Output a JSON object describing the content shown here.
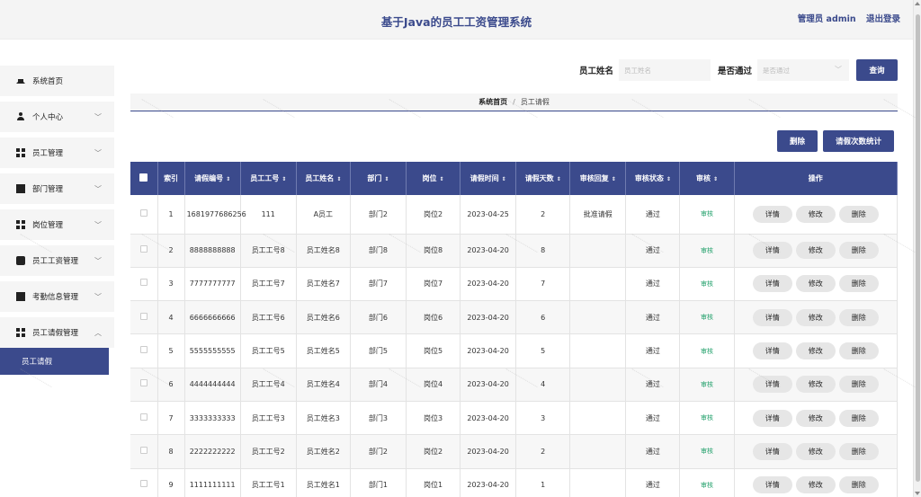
{
  "header": {
    "title": "基于Java的员工工资管理系统",
    "user": "管理员 admin",
    "logout": "退出登录"
  },
  "sidebar": {
    "items": [
      {
        "label": "系统首页",
        "icon": "home-icon"
      },
      {
        "label": "个人中心",
        "icon": "user-icon"
      },
      {
        "label": "员工管理",
        "icon": "grid-icon"
      },
      {
        "label": "部门管理",
        "icon": "trash-icon"
      },
      {
        "label": "岗位管理",
        "icon": "grid-icon"
      },
      {
        "label": "员工工资管理",
        "icon": "chat-icon"
      },
      {
        "label": "考勤信息管理",
        "icon": "chart-icon"
      },
      {
        "label": "员工请假管理",
        "icon": "grid-icon"
      }
    ],
    "active_sub": "员工请假"
  },
  "search": {
    "name_label": "员工姓名",
    "name_placeholder": "员工姓名",
    "pass_label": "是否通过",
    "pass_placeholder": "是否通过",
    "button": "查询"
  },
  "breadcrumb": {
    "home": "系统首页",
    "sep": "/",
    "current": "员工请假"
  },
  "actions": {
    "delete": "删除",
    "stats": "请假次数统计"
  },
  "table": {
    "headers": [
      "索引",
      "请假编号",
      "员工工号",
      "员工姓名",
      "部门",
      "岗位",
      "请假时间",
      "请假天数",
      "审核回复",
      "审核状态",
      "审核",
      "操作"
    ],
    "rows": [
      {
        "idx": "1",
        "code": "1681977686256",
        "emp_no": "111",
        "name": "A员工",
        "dept": "部门2",
        "post": "岗位2",
        "date": "2023-04-25",
        "days": "2",
        "reply": "批准请假",
        "status": "通过",
        "audit": "审核"
      },
      {
        "idx": "2",
        "code": "8888888888",
        "emp_no": "员工工号8",
        "name": "员工姓名8",
        "dept": "部门8",
        "post": "岗位8",
        "date": "2023-04-20",
        "days": "8",
        "reply": "",
        "status": "通过",
        "audit": "审核"
      },
      {
        "idx": "3",
        "code": "7777777777",
        "emp_no": "员工工号7",
        "name": "员工姓名7",
        "dept": "部门7",
        "post": "岗位7",
        "date": "2023-04-20",
        "days": "7",
        "reply": "",
        "status": "通过",
        "audit": "审核"
      },
      {
        "idx": "4",
        "code": "6666666666",
        "emp_no": "员工工号6",
        "name": "员工姓名6",
        "dept": "部门6",
        "post": "岗位6",
        "date": "2023-04-20",
        "days": "6",
        "reply": "",
        "status": "通过",
        "audit": "审核"
      },
      {
        "idx": "5",
        "code": "5555555555",
        "emp_no": "员工工号5",
        "name": "员工姓名5",
        "dept": "部门5",
        "post": "岗位5",
        "date": "2023-04-20",
        "days": "5",
        "reply": "",
        "status": "通过",
        "audit": "审核"
      },
      {
        "idx": "6",
        "code": "4444444444",
        "emp_no": "员工工号4",
        "name": "员工姓名4",
        "dept": "部门4",
        "post": "岗位4",
        "date": "2023-04-20",
        "days": "4",
        "reply": "",
        "status": "通过",
        "audit": "审核"
      },
      {
        "idx": "7",
        "code": "3333333333",
        "emp_no": "员工工号3",
        "name": "员工姓名3",
        "dept": "部门3",
        "post": "岗位3",
        "date": "2023-04-20",
        "days": "3",
        "reply": "",
        "status": "通过",
        "audit": "审核"
      },
      {
        "idx": "8",
        "code": "2222222222",
        "emp_no": "员工工号2",
        "name": "员工姓名2",
        "dept": "部门2",
        "post": "岗位2",
        "date": "2023-04-20",
        "days": "2",
        "reply": "",
        "status": "通过",
        "audit": "审核"
      },
      {
        "idx": "9",
        "code": "1111111111",
        "emp_no": "员工工号1",
        "name": "员工姓名1",
        "dept": "部门1",
        "post": "岗位1",
        "date": "2023-04-20",
        "days": "1",
        "reply": "",
        "status": "通过",
        "audit": "审核"
      }
    ],
    "op_detail": "详情",
    "op_edit": "修改",
    "op_delete": "删除"
  },
  "colors": {
    "primary": "#3b4a8c",
    "audit_green": "#22a06b"
  }
}
